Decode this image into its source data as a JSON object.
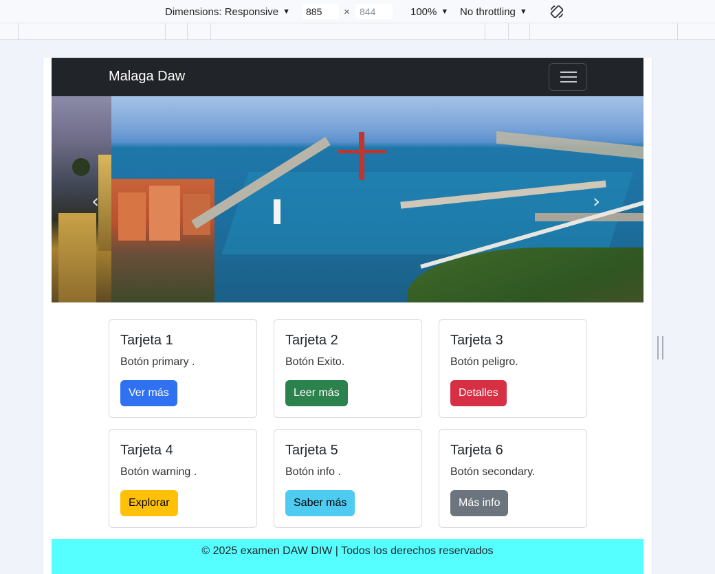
{
  "devtools": {
    "dimensions_label": "Dimensions: Responsive",
    "width_value": "885",
    "times": "×",
    "height_placeholder": "844",
    "zoom": "100%",
    "throttling": "No throttling",
    "icons": {
      "dimensions_caret": "caret-down-icon",
      "zoom_caret": "caret-down-icon",
      "throttling_caret": "caret-down-icon",
      "rotate": "rotate-device-icon"
    }
  },
  "navbar": {
    "brand": "Malaga Daw",
    "toggler_icon": "hamburger-menu-icon",
    "background": "#212529"
  },
  "carousel": {
    "prev_icon": "chevron-left-icon",
    "next_icon": "chevron-right-icon",
    "prev_glyph": "‹",
    "next_glyph": "›"
  },
  "cards": [
    {
      "title": "Tarjeta 1",
      "text": "Botón primary .",
      "button": "Ver más",
      "button_color": "#3071f2",
      "button_text_color": "#ffffff"
    },
    {
      "title": "Tarjeta 2",
      "text": "Botón Exito.",
      "button": "Leer más",
      "button_color": "#2b824d",
      "button_text_color": "#ffffff"
    },
    {
      "title": "Tarjeta 3",
      "text": "Botón peligro.",
      "button": "Detalles",
      "button_color": "#d72f43",
      "button_text_color": "#ffffff"
    },
    {
      "title": "Tarjeta 4",
      "text": "Botón warning .",
      "button": "Explorar",
      "button_color": "#ffc008",
      "button_text_color": "#000000"
    },
    {
      "title": "Tarjeta 5",
      "text": "Botón info .",
      "button": "Saber más",
      "button_color": "#4ecbf0",
      "button_text_color": "#000000"
    },
    {
      "title": "Tarjeta 6",
      "text": "Botón secondary.",
      "button": "Más info",
      "button_color": "#6c757d",
      "button_text_color": "#ffffff"
    }
  ],
  "footer": {
    "text": "© 2025 examen DAW DIW | Todos los derechos reservados",
    "background": "#55ffff"
  }
}
